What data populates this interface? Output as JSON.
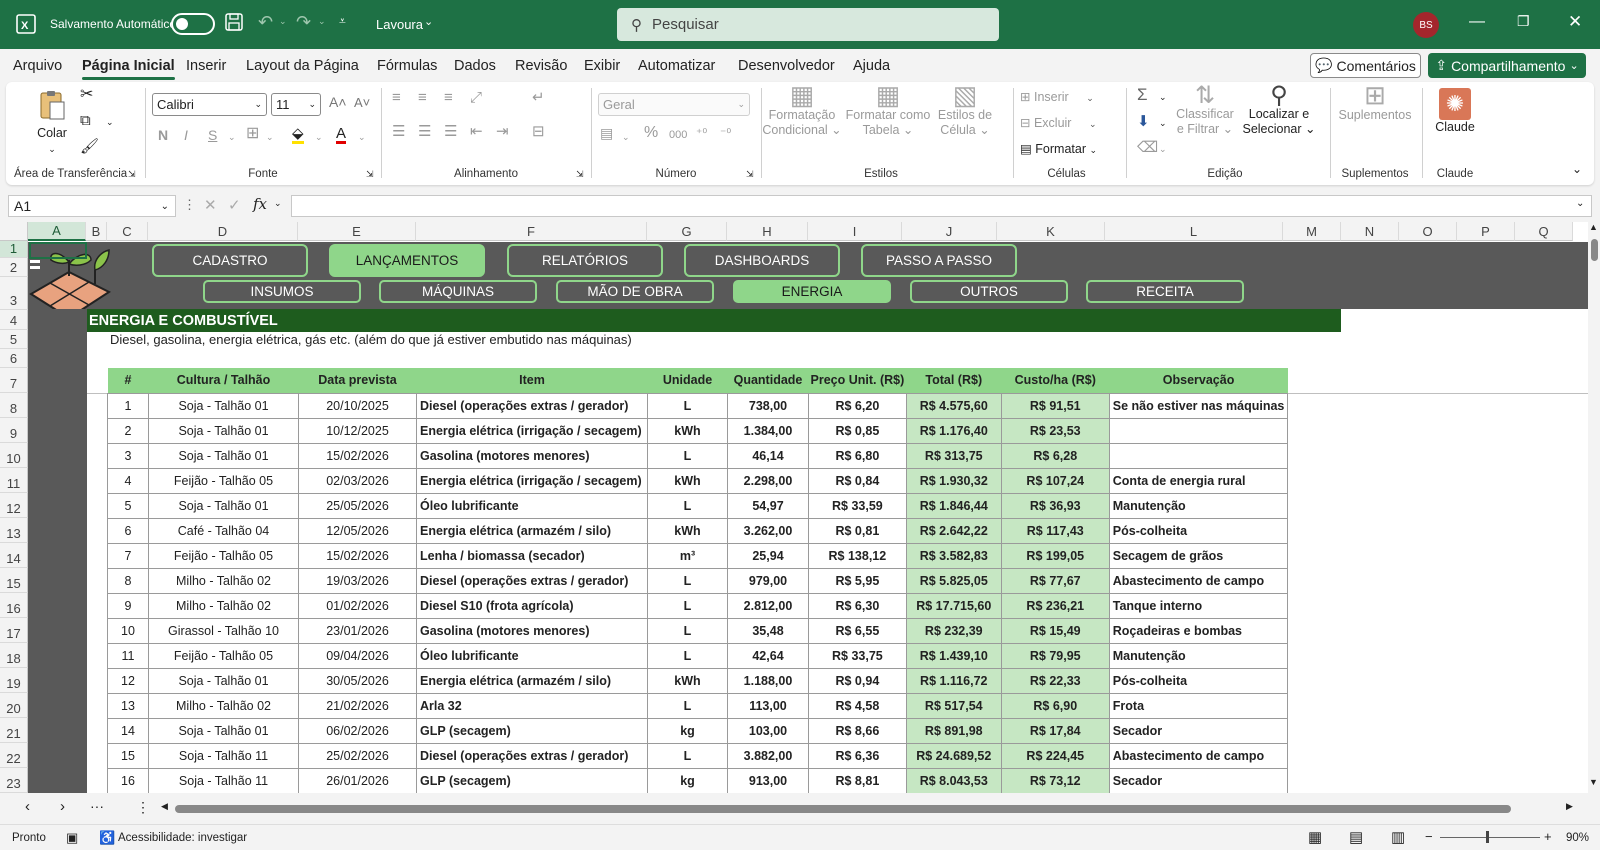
{
  "titlebar": {
    "autosave_label": "Salvamento Automático",
    "workbook_name": "Lavoura",
    "search_placeholder": "Pesquisar",
    "avatar_initials": "BS"
  },
  "menu": [
    "Arquivo",
    "Página Inicial",
    "Inserir",
    "Layout da Página",
    "Fórmulas",
    "Dados",
    "Revisão",
    "Exibir",
    "Automatizar",
    "Desenvolvedor",
    "Ajuda"
  ],
  "menu_active": "Página Inicial",
  "buttons": {
    "comments": "Comentários",
    "share": "Compartilhamento"
  },
  "ribbon": {
    "clipboard": {
      "paste": "Colar",
      "group": "Área de Transferência"
    },
    "font": {
      "name": "Calibri",
      "size": "11",
      "group": "Fonte"
    },
    "alignment": {
      "group": "Alinhamento"
    },
    "number": {
      "format": "Geral",
      "group": "Número"
    },
    "styles": {
      "cond_1": "Formatação",
      "cond_2": "Condicional",
      "table_1": "Formatar como",
      "table_2": "Tabela",
      "cell_1": "Estilos de",
      "cell_2": "Célula",
      "group": "Estilos"
    },
    "cells": {
      "insert": "Inserir",
      "delete": "Excluir",
      "format": "Formatar",
      "group": "Células"
    },
    "editing": {
      "sort_1": "Classificar",
      "sort_2": "e Filtrar",
      "find_1": "Localizar e",
      "find_2": "Selecionar",
      "group": "Edição"
    },
    "addins": {
      "label": "Suplementos",
      "group": "Suplementos"
    },
    "claude": {
      "label": "Claude",
      "group": "Claude"
    }
  },
  "namebox": "A1",
  "columns": [
    "A",
    "B",
    "C",
    "D",
    "E",
    "F",
    "G",
    "H",
    "I",
    "J",
    "K",
    "L",
    "M",
    "N",
    "O",
    "P",
    "Q"
  ],
  "rows": [
    "1",
    "2",
    "3",
    "4",
    "5",
    "6",
    "7",
    "8",
    "9",
    "10",
    "11",
    "12",
    "13",
    "14",
    "15",
    "16",
    "17",
    "18",
    "19",
    "20",
    "21",
    "22",
    "23"
  ],
  "nav_main": [
    {
      "label": "CADASTRO",
      "active": false
    },
    {
      "label": "LANÇAMENTOS",
      "active": true
    },
    {
      "label": "RELATÓRIOS",
      "active": false
    },
    {
      "label": "DASHBOARDS",
      "active": false
    },
    {
      "label": "PASSO A PASSO",
      "active": false
    }
  ],
  "nav_sub": [
    {
      "label": "INSUMOS",
      "active": false
    },
    {
      "label": "MÁQUINAS",
      "active": false
    },
    {
      "label": "MÃO DE OBRA",
      "active": false
    },
    {
      "label": "ENERGIA",
      "active": true
    },
    {
      "label": "OUTROS",
      "active": false
    },
    {
      "label": "RECEITA",
      "active": false
    }
  ],
  "section": {
    "title": "ENERGIA E COMBUSTÍVEL",
    "description": "Diesel, gasolina, energia elétrica, gás etc. (além do que já estiver embutido nas máquinas)"
  },
  "table": {
    "headers": [
      "#",
      "Cultura / Talhão",
      "Data prevista",
      "Item",
      "Unidade",
      "Quantidade",
      "Preço Unit. (R$)",
      "Total (R$)",
      "Custo/ha (R$)",
      "Observação"
    ],
    "rows": [
      [
        "1",
        "Soja - Talhão 01",
        "20/10/2025",
        "Diesel (operações extras / gerador)",
        "L",
        "738,00",
        "R$ 6,20",
        "R$ 4.575,60",
        "R$ 91,51",
        "Se não estiver nas máquinas"
      ],
      [
        "2",
        "Soja - Talhão 01",
        "10/12/2025",
        "Energia elétrica (irrigação / secagem)",
        "kWh",
        "1.384,00",
        "R$ 0,85",
        "R$ 1.176,40",
        "R$ 23,53",
        ""
      ],
      [
        "3",
        "Soja - Talhão 01",
        "15/02/2026",
        "Gasolina (motores menores)",
        "L",
        "46,14",
        "R$ 6,80",
        "R$ 313,75",
        "R$ 6,28",
        ""
      ],
      [
        "4",
        "Feijão - Talhão 05",
        "02/03/2026",
        "Energia elétrica (irrigação / secagem)",
        "kWh",
        "2.298,00",
        "R$ 0,84",
        "R$ 1.930,32",
        "R$ 107,24",
        "Conta de energia rural"
      ],
      [
        "5",
        "Soja - Talhão 01",
        "25/05/2026",
        "Óleo lubrificante",
        "L",
        "54,97",
        "R$ 33,59",
        "R$ 1.846,44",
        "R$ 36,93",
        "Manutenção"
      ],
      [
        "6",
        "Café - Talhão 04",
        "12/05/2026",
        "Energia elétrica (armazém / silo)",
        "kWh",
        "3.262,00",
        "R$ 0,81",
        "R$ 2.642,22",
        "R$ 117,43",
        "Pós-colheita"
      ],
      [
        "7",
        "Feijão - Talhão 05",
        "15/02/2026",
        "Lenha / biomassa (secador)",
        "m³",
        "25,94",
        "R$ 138,12",
        "R$ 3.582,83",
        "R$ 199,05",
        "Secagem de grãos"
      ],
      [
        "8",
        "Milho - Talhão 02",
        "19/03/2026",
        "Diesel (operações extras / gerador)",
        "L",
        "979,00",
        "R$ 5,95",
        "R$ 5.825,05",
        "R$ 77,67",
        "Abastecimento de campo"
      ],
      [
        "9",
        "Milho - Talhão 02",
        "01/02/2026",
        "Diesel S10 (frota agrícola)",
        "L",
        "2.812,00",
        "R$ 6,30",
        "R$ 17.715,60",
        "R$ 236,21",
        "Tanque interno"
      ],
      [
        "10",
        "Girassol - Talhão 10",
        "23/01/2026",
        "Gasolina (motores menores)",
        "L",
        "35,48",
        "R$ 6,55",
        "R$ 232,39",
        "R$ 15,49",
        "Roçadeiras e bombas"
      ],
      [
        "11",
        "Feijão - Talhão 05",
        "09/04/2026",
        "Óleo lubrificante",
        "L",
        "42,64",
        "R$ 33,75",
        "R$ 1.439,10",
        "R$ 79,95",
        "Manutenção"
      ],
      [
        "12",
        "Soja - Talhão 01",
        "30/05/2026",
        "Energia elétrica (armazém / silo)",
        "kWh",
        "1.188,00",
        "R$ 0,94",
        "R$ 1.116,72",
        "R$ 22,33",
        "Pós-colheita"
      ],
      [
        "13",
        "Milho - Talhão 02",
        "21/02/2026",
        "Arla 32",
        "L",
        "113,00",
        "R$ 4,58",
        "R$ 517,54",
        "R$ 6,90",
        "Frota"
      ],
      [
        "14",
        "Soja - Talhão 01",
        "06/02/2026",
        "GLP (secagem)",
        "kg",
        "103,00",
        "R$ 8,66",
        "R$ 891,98",
        "R$ 17,84",
        "Secador"
      ],
      [
        "15",
        "Soja - Talhão 11",
        "25/02/2026",
        "Diesel (operações extras / gerador)",
        "L",
        "3.882,00",
        "R$ 6,36",
        "R$ 24.689,52",
        "R$ 224,45",
        "Abastecimento de campo"
      ],
      [
        "16",
        "Soja - Talhão 11",
        "26/01/2026",
        "GLP (secagem)",
        "kg",
        "913,00",
        "R$ 8,81",
        "R$ 8.043,53",
        "R$ 73,12",
        "Secador"
      ]
    ]
  },
  "status": {
    "ready": "Pronto",
    "accessibility": "Acessibilidade: investigar",
    "zoom": "90%"
  },
  "colors": {
    "excel_green": "#1e7145",
    "nav_green": "#8fd68a",
    "banner_gray": "#595959",
    "section_green": "#1e5c1e",
    "total_fill": "#c6e7c3"
  }
}
